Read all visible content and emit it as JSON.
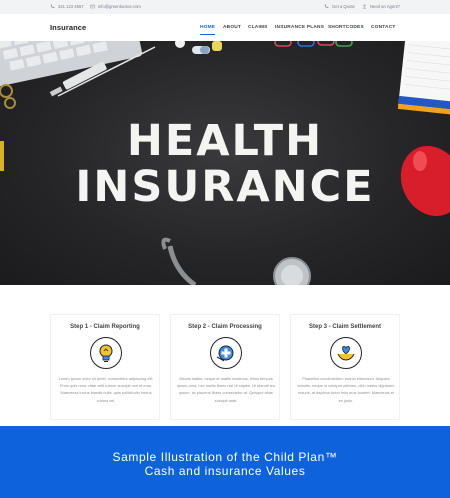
{
  "topbar": {
    "phone": "321 123 4567",
    "email": "info@greenlucsoe.com",
    "quote": "Get a Quote",
    "agent": "Need an Agent?"
  },
  "nav": {
    "brand": "Insurance",
    "items": [
      "HOME",
      "ABOUT",
      "CLAIMS",
      "INSURANCE PLANS",
      "SHORTCODES",
      "CONTACT"
    ],
    "active": "HOME"
  },
  "hero": {
    "line1": "HEALTH",
    "line2": "INSURANCE"
  },
  "steps": [
    {
      "title": "Step 1 - Claim Reporting",
      "icon": "lightbulb-icon",
      "text": "Lorem ipsum dolor sit amet, consectetur adipiscing elit. Proin quis nunc vitae velit rutrum suscipit non et eros. Maecenas luctus blandit nulla, quis sollicitudin metus cursus vel."
    },
    {
      "title": "Step 2 - Claim Processing",
      "icon": "medical-cross-icon",
      "text": "Mauris mattis, neque et mattis maximus, tellus tempus ipsum urna, nec mollis libero nisl ut sapien. Ut blandit leo ipsum, ac placerat libero consectetur at. Quisque vitae suscipit ante."
    },
    {
      "title": "Step 3 - Claim Settlement",
      "icon": "heart-hands-icon",
      "text": "Phasellus condimentum lacinia bibendum. Aliquam lobortis, neque id volutpat ultricies, nibh metus dignissim mauris, at dapibus tortor felis eros laoreet. Maecenas et ex justo."
    }
  ],
  "band": {
    "line1": "Sample Illustration of the Child Plan™",
    "line2": "Cash and insurance Values"
  },
  "colors": {
    "accent": "#1466e0",
    "band": "#0e63dc",
    "hero_bg": "#262628",
    "icon_blue": "#3a8ee6",
    "icon_yellow": "#f4c430"
  }
}
